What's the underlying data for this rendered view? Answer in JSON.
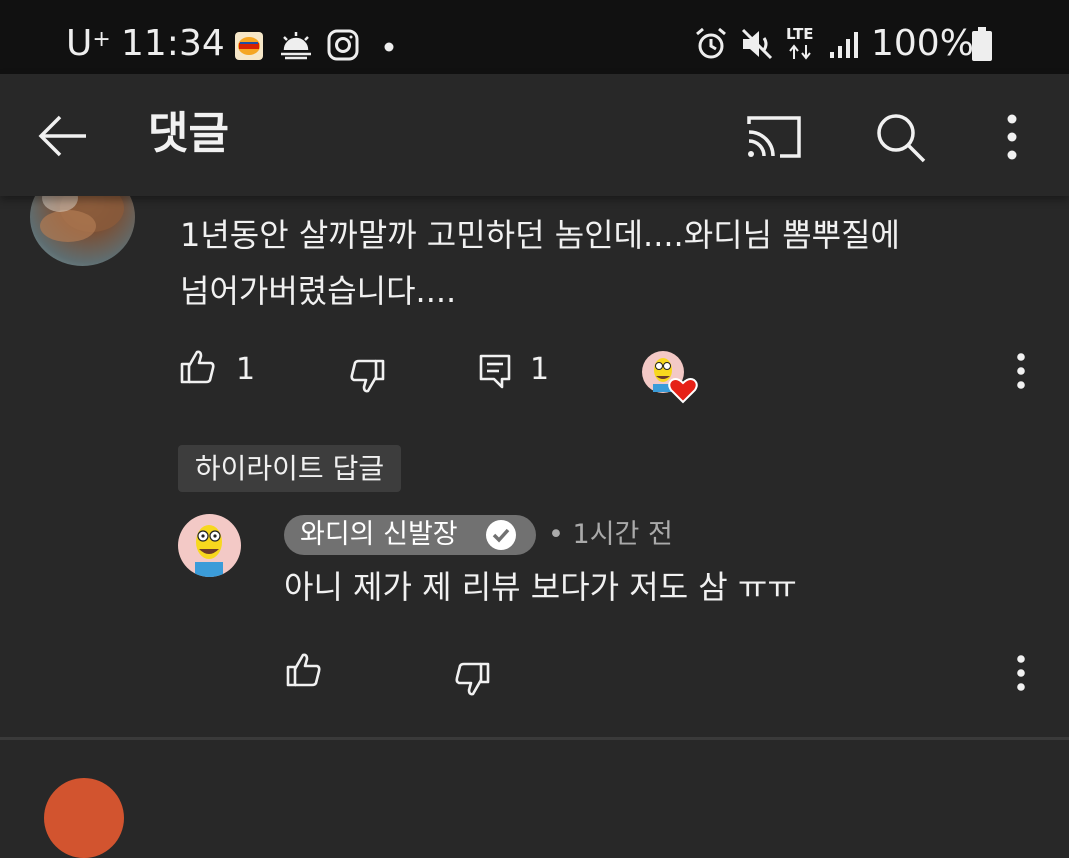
{
  "status_bar": {
    "carrier": "U",
    "carrier_sup": "+",
    "time": "11:34",
    "app_icons": [
      "burger-king-icon",
      "weather-sunrise-icon",
      "instagram-icon",
      "dot-icon"
    ],
    "system_icons": [
      "alarm-icon",
      "mute-icon",
      "lte-icon",
      "signal-icon"
    ],
    "lte_label": "LTE",
    "battery": "100%"
  },
  "header": {
    "title": "댓글",
    "icons": [
      "back-arrow-icon",
      "cast-icon",
      "search-icon",
      "more-vert-icon"
    ]
  },
  "comment": {
    "text_line1": "1년동안 살까말까 고민하던 놈인데....와디님 뽐뿌질에",
    "text_line2": "넘어가버렸습니다....",
    "like_count": "1",
    "reply_count": "1",
    "creator_heart": true
  },
  "highlight": {
    "label": "하이라이트 답글"
  },
  "reply": {
    "author": "와디의 신발장",
    "verified": true,
    "separator": "•",
    "time": "1시간 전",
    "text": "아니 제가 제 리뷰 보다가 저도 삼 ㅠㅠ"
  },
  "colors": {
    "background": "#282828",
    "status_bar": "#111111",
    "text": "#f1f1f1",
    "secondary_text": "#aaaaaa",
    "author_chip": "#717171",
    "heart": "#e62117"
  }
}
